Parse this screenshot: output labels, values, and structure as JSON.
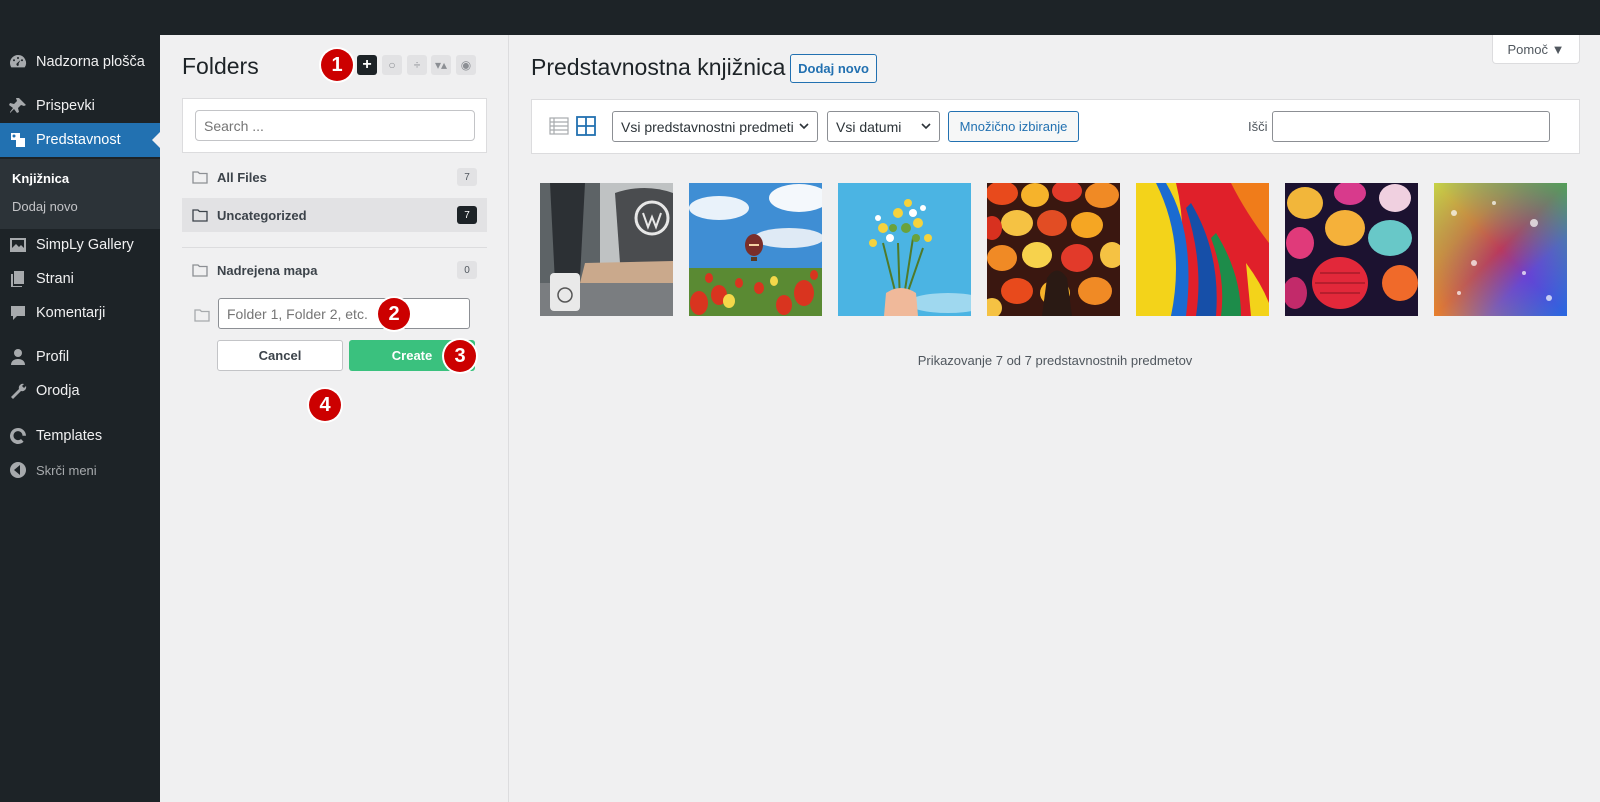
{
  "sidebar": {
    "items": [
      {
        "label": "Nadzorna plošča",
        "icon": "dashboard-icon"
      },
      {
        "label": "Prispevki",
        "icon": "pin-icon"
      },
      {
        "label": "Predstavnost",
        "icon": "media-icon"
      },
      {
        "label": "SimpLy Gallery",
        "icon": "gallery-icon"
      },
      {
        "label": "Strani",
        "icon": "pages-icon"
      },
      {
        "label": "Komentarji",
        "icon": "comment-icon"
      },
      {
        "label": "Profil",
        "icon": "user-icon"
      },
      {
        "label": "Orodja",
        "icon": "wrench-icon"
      },
      {
        "label": "Templates",
        "icon": "templates-icon"
      },
      {
        "label": "Skrči meni",
        "icon": "collapse-icon"
      }
    ],
    "submenu": [
      {
        "label": "Knjižnica"
      },
      {
        "label": "Dodaj novo"
      }
    ],
    "active": "Predstavnost"
  },
  "folders": {
    "title": "Folders",
    "toolbar": [
      "plus-icon",
      "circle-icon",
      "sort-icon",
      "collapse-arrows-icon",
      "eye-icon"
    ],
    "search_placeholder": "Search ...",
    "items": [
      {
        "label": "All Files",
        "count": "7"
      },
      {
        "label": "Uncategorized",
        "count": "7"
      },
      {
        "label": "Nadrejena mapa",
        "count": "0"
      }
    ],
    "new_folder_placeholder": "Folder 1, Folder 2, etc.",
    "cancel_label": "Cancel",
    "create_label": "Create"
  },
  "markers": [
    "1",
    "2",
    "3",
    "4"
  ],
  "main": {
    "help_label": "Pomoč ▼",
    "title": "Predstavnostna knjižnica",
    "add_new_label": "Dodaj novo",
    "filter_type": "Vsi predstavnostni predmeti",
    "filter_date": "Vsi datumi",
    "bulk_select_label": "Množično izbiranje",
    "search_label": "Išči",
    "search_value": "",
    "count_text": "Prikazovanje 7 od 7 predstavnostnih predmetov",
    "thumbnails": [
      "laptop-photo",
      "balloon-tulips-photo",
      "flowers-sky-photo",
      "lanterns-photo",
      "feathers-photo",
      "lanterns-night-photo",
      "glitter-photo"
    ]
  },
  "colors": {
    "admin_dark": "#1d2327",
    "accent_blue": "#2271b1",
    "create_green": "#3ac17e",
    "marker_red": "#cc0000"
  }
}
